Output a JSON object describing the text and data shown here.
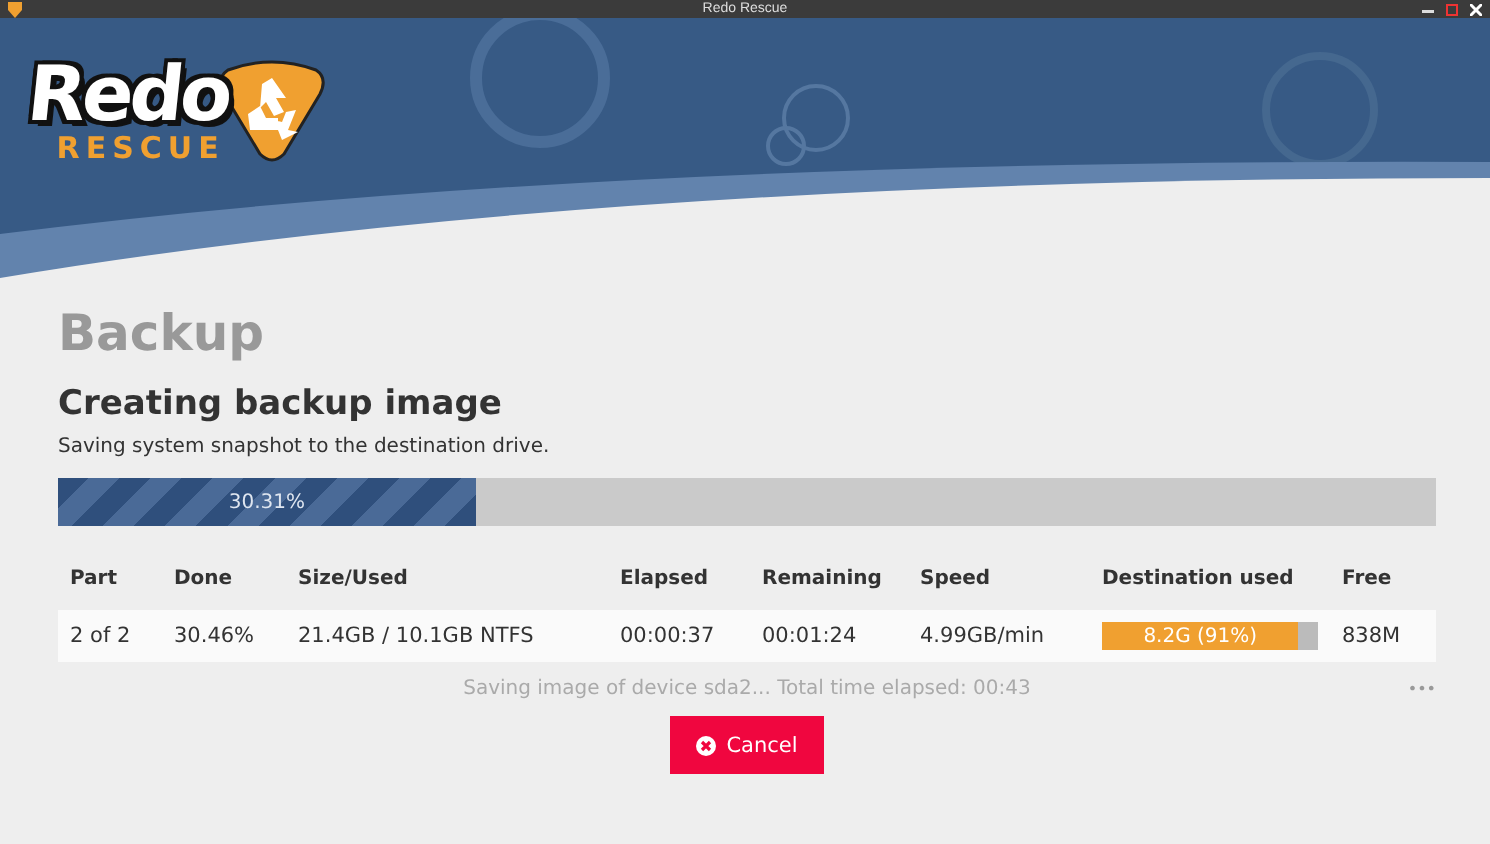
{
  "window": {
    "title": "Redo Rescue"
  },
  "logo": {
    "word": "Redo",
    "tagline": "RESCUE"
  },
  "page": {
    "title": "Backup",
    "heading": "Creating backup image",
    "description": "Saving system snapshot to the destination drive."
  },
  "progress": {
    "level": 0.3031,
    "label": "30.31%"
  },
  "table": {
    "columns": [
      "Part",
      "Done",
      "Size/Used",
      "Elapsed",
      "Remaining",
      "Speed",
      "Destination used",
      "Free"
    ],
    "rows": [
      {
        "part": "2 of 2",
        "done": "30.46%",
        "size_used": "21.4GB / 10.1GB NTFS",
        "elapsed": "00:00:37",
        "remaining": "00:01:24",
        "speed": "4.99GB/min",
        "destination_used": {
          "level": 0.91,
          "label": "8.2G (91%)"
        },
        "free": "838M"
      }
    ]
  },
  "status": {
    "text": "Saving image of device sda2... Total time elapsed: 00:43",
    "more": "•••"
  },
  "buttons": [
    {
      "kind": "cancel",
      "label": "Cancel"
    }
  ]
}
